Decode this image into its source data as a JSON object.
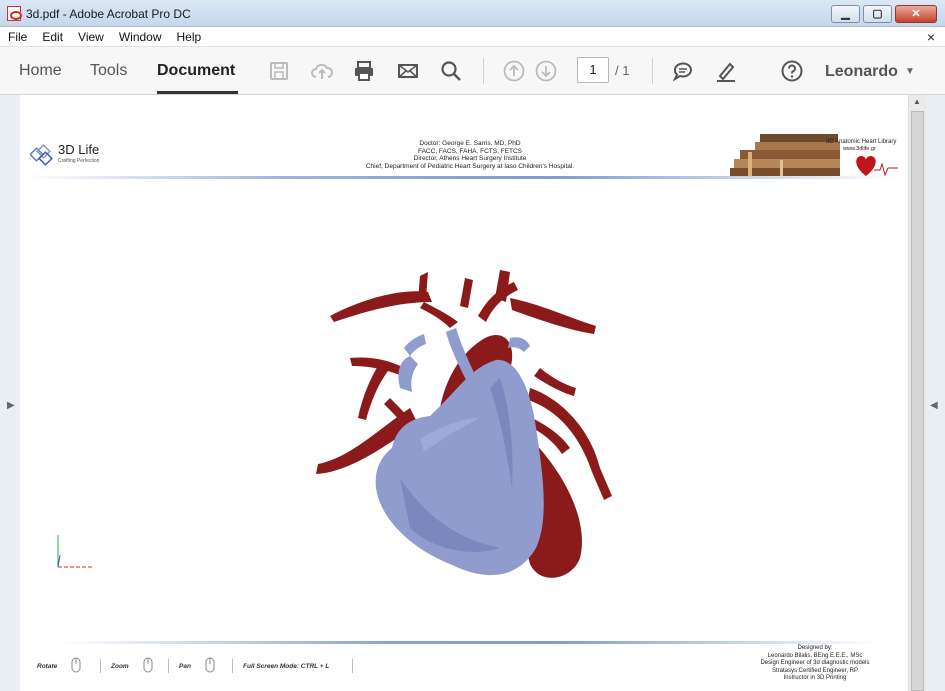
{
  "window": {
    "title": "3d.pdf - Adobe Acrobat Pro DC"
  },
  "menu": [
    "File",
    "Edit",
    "View",
    "Window",
    "Help"
  ],
  "menu_close": "×",
  "toolbar": {
    "tabs": [
      "Home",
      "Tools",
      "Document"
    ],
    "active_tab": "Document",
    "page_current": "1",
    "page_total": "/ 1",
    "user": "Leonardo"
  },
  "pdf": {
    "logo_name": "3D Life",
    "logo_tagline": "Crafting Perfection",
    "doctor_lines": [
      "Doctor: George E. Sarris, MD, PhD",
      "FACC, FACS, FAHA, FCTS, FETCS",
      "Director, Athens Heart Surgery Institute",
      "Chief, Department of Pediatric Heart Surgery at Iaso Children's Hospital."
    ],
    "library_title": "3D Anatomic Heart Library",
    "library_url": "www.3dlife.gr",
    "controls": [
      {
        "label": "Rotate"
      },
      {
        "label": "Zoom"
      },
      {
        "label": "Pan"
      },
      {
        "label": "Full Screen Mode:  CTRL + L"
      }
    ],
    "designed_lines": [
      "Designed by:",
      "Leonardo Bilalis, BEng E.E.E., MSc",
      "Design Engineer of 3d diagnostic models",
      "Stratasys Certified Engineer, RP",
      "Instructor in 3D Printing"
    ]
  },
  "colors": {
    "artery": "#8b1a1a",
    "ventricle": "#8f9ccd",
    "accent": "#7f9ccd"
  }
}
